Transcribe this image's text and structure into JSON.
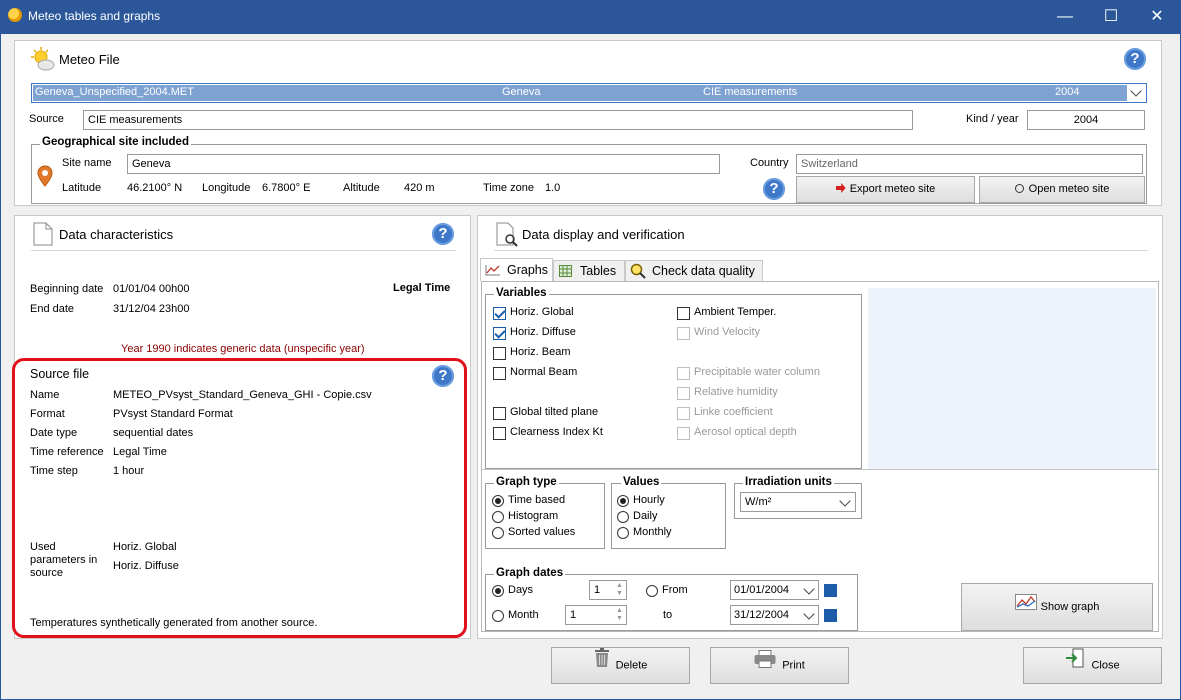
{
  "window": {
    "title": "Meteo tables and graphs"
  },
  "meteo": {
    "section_title": "Meteo File",
    "selected_file": {
      "name": "Geneva_Unspecified_2004.MET",
      "site": "Geneva",
      "source": "CIE measurements",
      "year": "2004"
    },
    "source_label": "Source",
    "source_value": "CIE measurements",
    "kind_label": "Kind / year",
    "kind_value": "2004",
    "geo": {
      "title": "Geographical site included",
      "site_label": "Site name",
      "site_value": "Geneva",
      "country_label": "Country",
      "country_value": "Switzerland",
      "lat_label": "Latitude",
      "lat_value": "46.2100° N",
      "lon_label": "Longitude",
      "lon_value": "6.7800° E",
      "alt_label": "Altitude",
      "alt_value": "420 m",
      "tz_label": "Time zone",
      "tz_value": "1.0",
      "export_label": "Export meteo site",
      "open_label": "Open meteo site"
    }
  },
  "characteristics": {
    "title": "Data characteristics",
    "begin_label": "Beginning date",
    "begin_value": "01/01/04 00h00",
    "end_label": "End date",
    "end_value": "31/12/04 23h00",
    "legal_time": "Legal Time",
    "generic_note": "Year 1990 indicates generic data (unspecific year)",
    "accent_color": "#8b0000",
    "source_file": {
      "title": "Source file",
      "name_label": "Name",
      "name_value": "METEO_PVsyst_Standard_Geneva_GHI - Copie.csv",
      "format_label": "Format",
      "format_value": "PVsyst Standard Format",
      "datetype_label": "Date type",
      "datetype_value": "sequential dates",
      "timeref_label": "Time reference",
      "timeref_value": "Legal Time",
      "timestep_label": "Time step",
      "timestep_value": "1 hour",
      "used_label_1": "Used",
      "used_label_2": "parameters in",
      "used_label_3": "source",
      "used_values": [
        "Horiz. Global",
        "Horiz. Diffuse"
      ],
      "footer_note": "Temperatures synthetically generated from another source.",
      "highlight_color": "#e0101a"
    }
  },
  "display": {
    "title": "Data display and verification",
    "tabs": [
      "Graphs",
      "Tables",
      "Check data quality"
    ],
    "variables_title": "Variables",
    "variables_left": [
      {
        "label": "Horiz. Global",
        "checked": true
      },
      {
        "label": "Horiz. Diffuse",
        "checked": true
      },
      {
        "label": "Horiz. Beam",
        "checked": false
      },
      {
        "label": "Normal Beam",
        "checked": false
      },
      {
        "label": "Global tilted plane",
        "checked": false
      },
      {
        "label": "Clearness Index Kt",
        "checked": false
      }
    ],
    "variables_right": [
      {
        "label": "Ambient Temper.",
        "checked": false,
        "disabled": false
      },
      {
        "label": "Wind Velocity",
        "checked": false,
        "disabled": true
      },
      {
        "label": "Precipitable water column",
        "checked": false,
        "disabled": true
      },
      {
        "label": "Relative humidity",
        "checked": false,
        "disabled": true
      },
      {
        "label": "Linke coefficient",
        "checked": false,
        "disabled": true
      },
      {
        "label": "Aerosol optical depth",
        "checked": false,
        "disabled": true
      }
    ],
    "graph_type_title": "Graph type",
    "graph_types": [
      "Time based",
      "Histogram",
      "Sorted values"
    ],
    "graph_type_selected": 0,
    "values_title": "Values",
    "values": [
      "Hourly",
      "Daily",
      "Monthly"
    ],
    "values_selected": 0,
    "irr_title": "Irradiation units",
    "irr_value": "W/m²",
    "dates_title": "Graph dates",
    "days_label": "Days",
    "days_value": "1",
    "month_label": "Month",
    "month_value": "1",
    "from_label": "From",
    "from_value": "01/01/2004",
    "to_label": "to",
    "to_value": "31/12/2004",
    "show_graph_label": "Show graph"
  },
  "footer": {
    "delete_label": "Delete",
    "print_label": "Print",
    "close_label": "Close"
  }
}
